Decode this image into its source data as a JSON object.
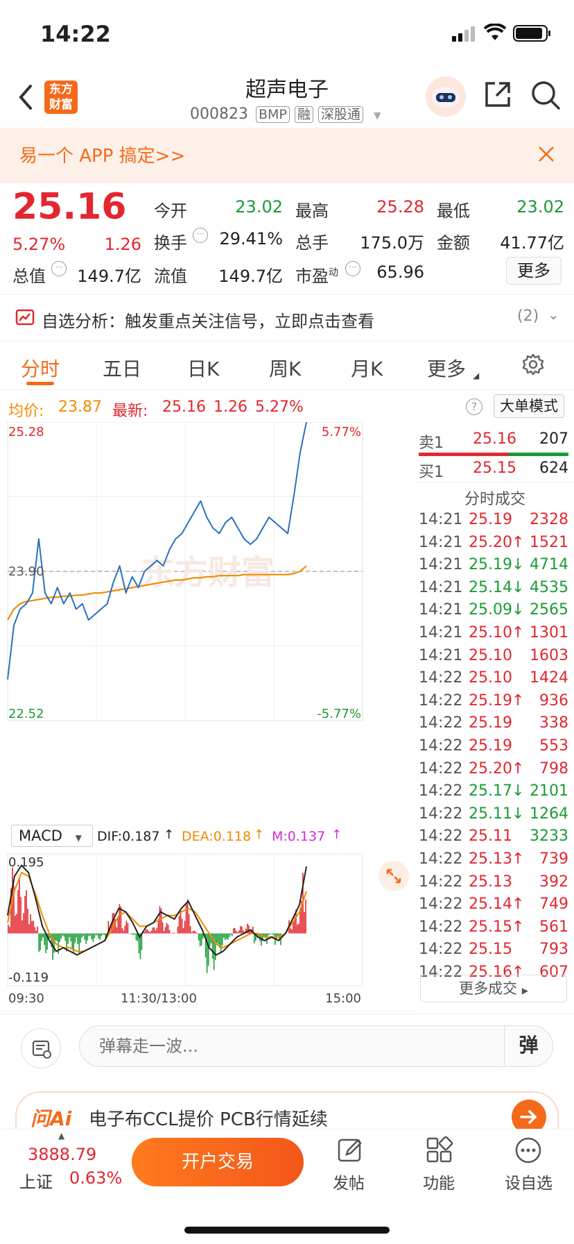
{
  "status": {
    "time": "14:22"
  },
  "nav": {
    "title": "超声电子",
    "code": "000823",
    "tags": [
      "BMP",
      "融",
      "深股通"
    ],
    "logo_text": [
      "东方",
      "财富"
    ]
  },
  "banner": {
    "text": "易一个 APP 搞定>>"
  },
  "quote": {
    "price": "25.16",
    "change_pct": "5.27%",
    "change": "1.26",
    "open_label": "今开",
    "open": "23.02",
    "high_label": "最高",
    "high": "25.28",
    "low_label": "最低",
    "low": "23.02",
    "turnover_label": "换手",
    "turnover": "29.41%",
    "volume_label": "总手",
    "volume": "175.0万",
    "amount_label": "金额",
    "amount": "41.77亿",
    "mcap_label": "总值",
    "mcap": "149.7亿",
    "float_label": "流值",
    "float_cap": "149.7亿",
    "pe_label": "市盈",
    "pe_sup": "动",
    "pe": "65.96",
    "more_label": "更多"
  },
  "signal": {
    "text": "自选分析：触发重点关注信号，立即点击查看",
    "count": "(2)"
  },
  "tabs": {
    "items": [
      "分时",
      "五日",
      "日K",
      "周K",
      "月K",
      "更多"
    ],
    "active": 0
  },
  "avg_bar": {
    "avg_label": "均价:",
    "avg": "23.87",
    "latest_label": "最新:",
    "latest": "25.16",
    "change": "1.26",
    "pct": "5.27%",
    "mode_label": "大单模式"
  },
  "chart_data": {
    "type": "line",
    "title": "",
    "ylim": [
      22.52,
      25.28
    ],
    "y_top_label": "25.28",
    "y_mid_label": "23.90",
    "y_bottom_label": "22.52",
    "pct_top_label": "5.77%",
    "pct_bottom_label": "-5.77%",
    "x_labels": [
      "09:30",
      "11:30/13:00",
      "15:00"
    ],
    "series": [
      {
        "name": "",
        "color": "#2a6fbf",
        "values": [
          22.9,
          23.4,
          23.55,
          23.6,
          23.7,
          24.2,
          23.7,
          23.6,
          23.75,
          23.6,
          23.7,
          23.55,
          23.6,
          23.45,
          23.5,
          23.55,
          23.6,
          23.8,
          23.95,
          23.7,
          23.85,
          23.75,
          23.9,
          23.95,
          24.0,
          23.95,
          24.1,
          24.2,
          24.25,
          24.35,
          24.45,
          24.55,
          24.4,
          24.3,
          24.25,
          24.35,
          24.4,
          24.3,
          24.2,
          24.15,
          24.2,
          24.3,
          24.4,
          24.35,
          24.3,
          24.25,
          24.6,
          25.0,
          25.28
        ]
      },
      {
        "name": "",
        "color": "#f28a00",
        "values": [
          23.45,
          23.55,
          23.6,
          23.62,
          23.63,
          23.64,
          23.65,
          23.66,
          23.66,
          23.67,
          23.67,
          23.68,
          23.68,
          23.69,
          23.7,
          23.7,
          23.71,
          23.72,
          23.73,
          23.74,
          23.75,
          23.76,
          23.77,
          23.78,
          23.79,
          23.8,
          23.81,
          23.82,
          23.82,
          23.83,
          23.84,
          23.84,
          23.85,
          23.85,
          23.86,
          23.86,
          23.86,
          23.86,
          23.87,
          23.87,
          23.87,
          23.87,
          23.87,
          23.87,
          23.87,
          23.87,
          23.88,
          23.9,
          23.95
        ]
      }
    ],
    "macd": {
      "label": "MACD",
      "dif_label": "DIF:0.187",
      "dea_label": "DEA:0.118",
      "m_label": "M:0.137",
      "ylim": [
        -0.119,
        0.195
      ],
      "top_label": "0.195",
      "bottom_label": "-0.119",
      "dif": [
        0.05,
        0.16,
        0.19,
        0.17,
        0.1,
        0.02,
        -0.02,
        -0.05,
        -0.04,
        -0.05,
        -0.06,
        -0.05,
        -0.04,
        -0.03,
        -0.02,
        0.03,
        0.07,
        0.06,
        0.03,
        -0.01,
        0.02,
        0.03,
        0.06,
        0.05,
        0.04,
        0.07,
        0.09,
        0.05,
        0.01,
        -0.04,
        -0.06,
        -0.05,
        -0.03,
        -0.01,
        0.0,
        0.01,
        -0.01,
        -0.02,
        -0.01,
        -0.02,
        0.0,
        0.04,
        0.08,
        0.187
      ],
      "dea": [
        0.03,
        0.12,
        0.17,
        0.16,
        0.11,
        0.05,
        0.0,
        -0.03,
        -0.04,
        -0.04,
        -0.05,
        -0.05,
        -0.04,
        -0.03,
        -0.02,
        0.01,
        0.05,
        0.06,
        0.04,
        0.02,
        0.02,
        0.03,
        0.04,
        0.05,
        0.05,
        0.06,
        0.07,
        0.06,
        0.03,
        0.0,
        -0.03,
        -0.04,
        -0.03,
        -0.02,
        -0.01,
        0.0,
        0.0,
        -0.01,
        -0.01,
        -0.01,
        0.0,
        0.03,
        0.06,
        0.118
      ]
    }
  },
  "orderbook": {
    "sell_label": "卖1",
    "sell_price": "25.16",
    "sell_vol": "207",
    "buy_label": "买1",
    "buy_price": "25.15",
    "buy_vol": "624",
    "trades_title": "分时成交",
    "trades": [
      {
        "t": "14:21",
        "p": "25.19",
        "v": "2328",
        "d": ""
      },
      {
        "t": "14:21",
        "p": "25.20",
        "v": "1521",
        "d": "↑"
      },
      {
        "t": "14:21",
        "p": "25.19",
        "v": "4714",
        "d": "↓"
      },
      {
        "t": "14:21",
        "p": "25.14",
        "v": "4535",
        "d": "↓"
      },
      {
        "t": "14:21",
        "p": "25.09",
        "v": "2565",
        "d": "↓"
      },
      {
        "t": "14:21",
        "p": "25.10",
        "v": "1301",
        "d": "↑"
      },
      {
        "t": "14:21",
        "p": "25.10",
        "v": "1603",
        "d": ""
      },
      {
        "t": "14:22",
        "p": "25.10",
        "v": "1424",
        "d": ""
      },
      {
        "t": "14:22",
        "p": "25.19",
        "v": "936",
        "d": "↑"
      },
      {
        "t": "14:22",
        "p": "25.19",
        "v": "338",
        "d": ""
      },
      {
        "t": "14:22",
        "p": "25.19",
        "v": "553",
        "d": ""
      },
      {
        "t": "14:22",
        "p": "25.20",
        "v": "798",
        "d": "↑"
      },
      {
        "t": "14:22",
        "p": "25.17",
        "v": "2101",
        "d": "↓"
      },
      {
        "t": "14:22",
        "p": "25.11",
        "v": "1264",
        "d": "↓"
      },
      {
        "t": "14:22",
        "p": "25.11",
        "v": "3233",
        "d": ""
      },
      {
        "t": "14:22",
        "p": "25.13",
        "v": "739",
        "d": "↑"
      },
      {
        "t": "14:22",
        "p": "25.13",
        "v": "392",
        "d": ""
      },
      {
        "t": "14:22",
        "p": "25.14",
        "v": "749",
        "d": "↑"
      },
      {
        "t": "14:22",
        "p": "25.15",
        "v": "561",
        "d": "↑"
      },
      {
        "t": "14:22",
        "p": "25.15",
        "v": "793",
        "d": ""
      },
      {
        "t": "14:22",
        "p": "25.16",
        "v": "607",
        "d": "↑"
      }
    ],
    "more_label": "更多成交"
  },
  "danmu": {
    "placeholder": "弹幕走一波...",
    "send_label": "弹"
  },
  "ai": {
    "logo": "问Ai",
    "text": "电子布CCL提价 PCB行情延续"
  },
  "bottom": {
    "index_value": "3888.79",
    "index_name": "上证",
    "index_pct": "0.63%",
    "trade_label": "开户交易",
    "post_label": "发帖",
    "func_label": "功能",
    "watch_label": "设自选"
  },
  "colors": {
    "up": "#e3262f",
    "down": "#1a9b35",
    "accent": "#f46a1a",
    "avg": "#f28a00",
    "price_line": "#2a6fbf"
  }
}
